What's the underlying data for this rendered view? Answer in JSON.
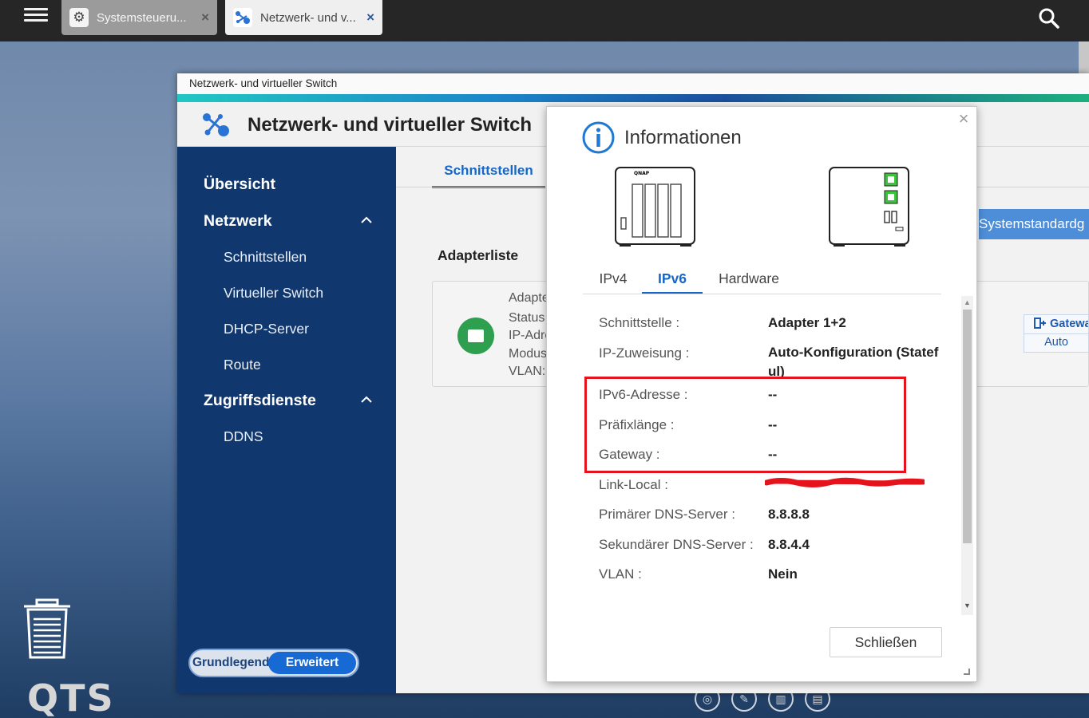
{
  "taskbar": {
    "tabs": [
      {
        "label": "Systemsteueru...",
        "icon": "gear-icon"
      },
      {
        "label": "Netzwerk- und v...",
        "icon": "network-icon"
      }
    ]
  },
  "desktop": {
    "logo_text": "QTS"
  },
  "window": {
    "title": "Netzwerk- und virtueller Switch",
    "app_name": "Netzwerk- und virtueller Switch"
  },
  "sidebar": {
    "overview": "Übersicht",
    "network_section": "Netzwerk",
    "network_items": [
      "Schnittstellen",
      "Virtueller Switch",
      "DHCP-Server",
      "Route"
    ],
    "access_section": "Zugriffsdienste",
    "access_items": [
      "DDNS"
    ],
    "mode_basic": "Grundlegend",
    "mode_advanced": "Erweitert"
  },
  "content": {
    "tab": "Schnittstellen",
    "adapter_list_title": "Adapterliste",
    "adapter_labels": [
      "Adapte",
      "Status",
      "IP-Adre",
      "Modus",
      "VLAN:"
    ],
    "system_button": "Systemstandardg",
    "gateway_label": "Gatewa",
    "gateway_value": "Auto"
  },
  "dialog": {
    "title": "Informationen",
    "tabs": [
      "IPv4",
      "IPv6",
      "Hardware"
    ],
    "active_tab": "IPv6",
    "rows": [
      {
        "label": "Schnittstelle :",
        "value": "Adapter 1+2"
      },
      {
        "label": "IP-Zuweisung :",
        "value": "Auto-Konfiguration (Statef ul)"
      },
      {
        "label": "IPv6-Adresse :",
        "value": "--"
      },
      {
        "label": "Präfixlänge :",
        "value": "--"
      },
      {
        "label": "Gateway :",
        "value": "--"
      },
      {
        "label": "Link-Local :",
        "value": ""
      },
      {
        "label": "Primärer DNS-Server :",
        "value": "8.8.8.8"
      },
      {
        "label": "Sekundärer DNS-Server :",
        "value": "8.8.4.4"
      },
      {
        "label": "VLAN :",
        "value": "Nein"
      }
    ],
    "close_button": "Schließen",
    "highlight_color": "#e5131c"
  },
  "colors": {
    "sidebar_bg": "#10386e",
    "accent": "#1767c7",
    "taskbar_bg": "#262626"
  }
}
